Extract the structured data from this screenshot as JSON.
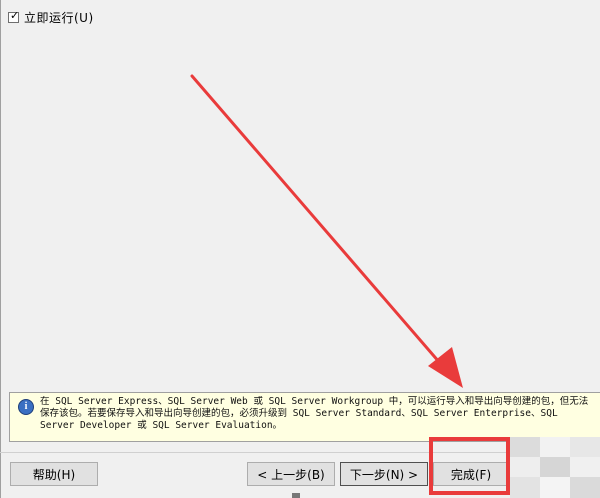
{
  "checkbox": {
    "label": "立即运行(U)",
    "checked": true
  },
  "info": {
    "lines": [
      "在 SQL Server Express、SQL Server Web 或 SQL Server Workgroup 中，可以运行导入和导出向导创建的包，但无法",
      "保存该包。若要保存导入和导出向导创建的包，必须升级到 SQL Server Standard、SQL Server Enterprise、SQL",
      "Server Developer 或 SQL Server Evaluation。"
    ]
  },
  "buttons": {
    "help": "帮助(H)",
    "prev": "< 上一步(B)",
    "next": "下一步(N) >",
    "finish": "完成(F)"
  },
  "colors": {
    "annotation_red": "#e93b3b",
    "info_background": "#ffffe1"
  }
}
